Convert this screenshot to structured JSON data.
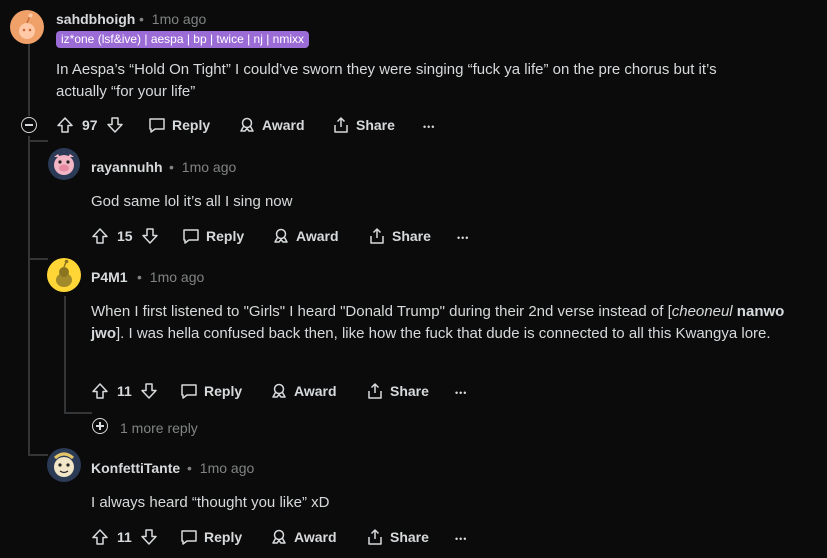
{
  "comments": [
    {
      "username": "sahdbhoigh",
      "time": "1mo ago",
      "flair": "iz*one (lsf&ive) | aespa | bp | twice | nj | nmixx",
      "body": "In Aespa’s “Hold On Tight” I could’ve sworn they were singing “fuck ya life” on the pre chorus but it’s actually “for your life”",
      "votes": "97"
    },
    {
      "username": "rayannuhh",
      "time": "1mo ago",
      "body": "God same lol it’s all I sing now",
      "votes": "15"
    },
    {
      "username": "P4M1",
      "time": "1mo ago",
      "body_parts": {
        "p1": "When I first listened to \"Girls\" I heard \"Donald Trump\" during their 2nd verse instead of [",
        "p2_italic": "cheoneul",
        "p3_bold": " nanwo jwo",
        "p4": "]. I was hella confused back then, like how the fuck that dude is connected to all this Kwangya lore."
      },
      "votes": "11"
    },
    {
      "username": "KonfettiTante",
      "time": "1mo ago",
      "body": "I always heard “thought you like” xD",
      "votes": "11"
    }
  ],
  "actions": {
    "reply": "Reply",
    "award": "Award",
    "share": "Share",
    "more": "•••",
    "dot": "•"
  },
  "more_replies": "1 more reply",
  "colors": {
    "background": "#0b0b0b",
    "flair_bg": "#9b6cd6",
    "avatar_orange": "#f0a16a",
    "avatar_yellow": "#ffd635"
  }
}
